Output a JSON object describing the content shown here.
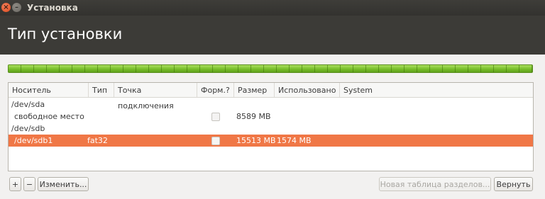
{
  "window": {
    "title": "Установка",
    "close_icon": "×",
    "minimize_icon": "–"
  },
  "header": {
    "title": "Тип установки"
  },
  "table": {
    "columns": [
      "Носитель",
      "Тип",
      "Точка подключения",
      "Форм.?",
      "Размер",
      "Использовано",
      "System"
    ],
    "rows": [
      {
        "device": "/dev/sda",
        "type": "",
        "mount": "",
        "format": null,
        "size": "",
        "used": "",
        "system": ""
      },
      {
        "device": "свободное место",
        "type": "",
        "mount": "",
        "format": false,
        "size": "8589 MB",
        "used": "",
        "system": ""
      },
      {
        "device": "/dev/sdb",
        "type": "",
        "mount": "",
        "format": null,
        "size": "",
        "used": "",
        "system": ""
      },
      {
        "device": "/dev/sdb1",
        "type": "fat32",
        "mount": "",
        "format": false,
        "size": "15513 MB",
        "used": "1574 MB",
        "system": "",
        "selected": true
      }
    ]
  },
  "toolbar": {
    "add_label": "+",
    "remove_label": "−",
    "change_label": "Изменить...",
    "new_table_label": "Новая таблица разделов...",
    "revert_label": "Вернуть"
  },
  "colors": {
    "selection": "#f07746",
    "partition_bar": "#78be2a",
    "header_bg": "#3c3b37"
  }
}
